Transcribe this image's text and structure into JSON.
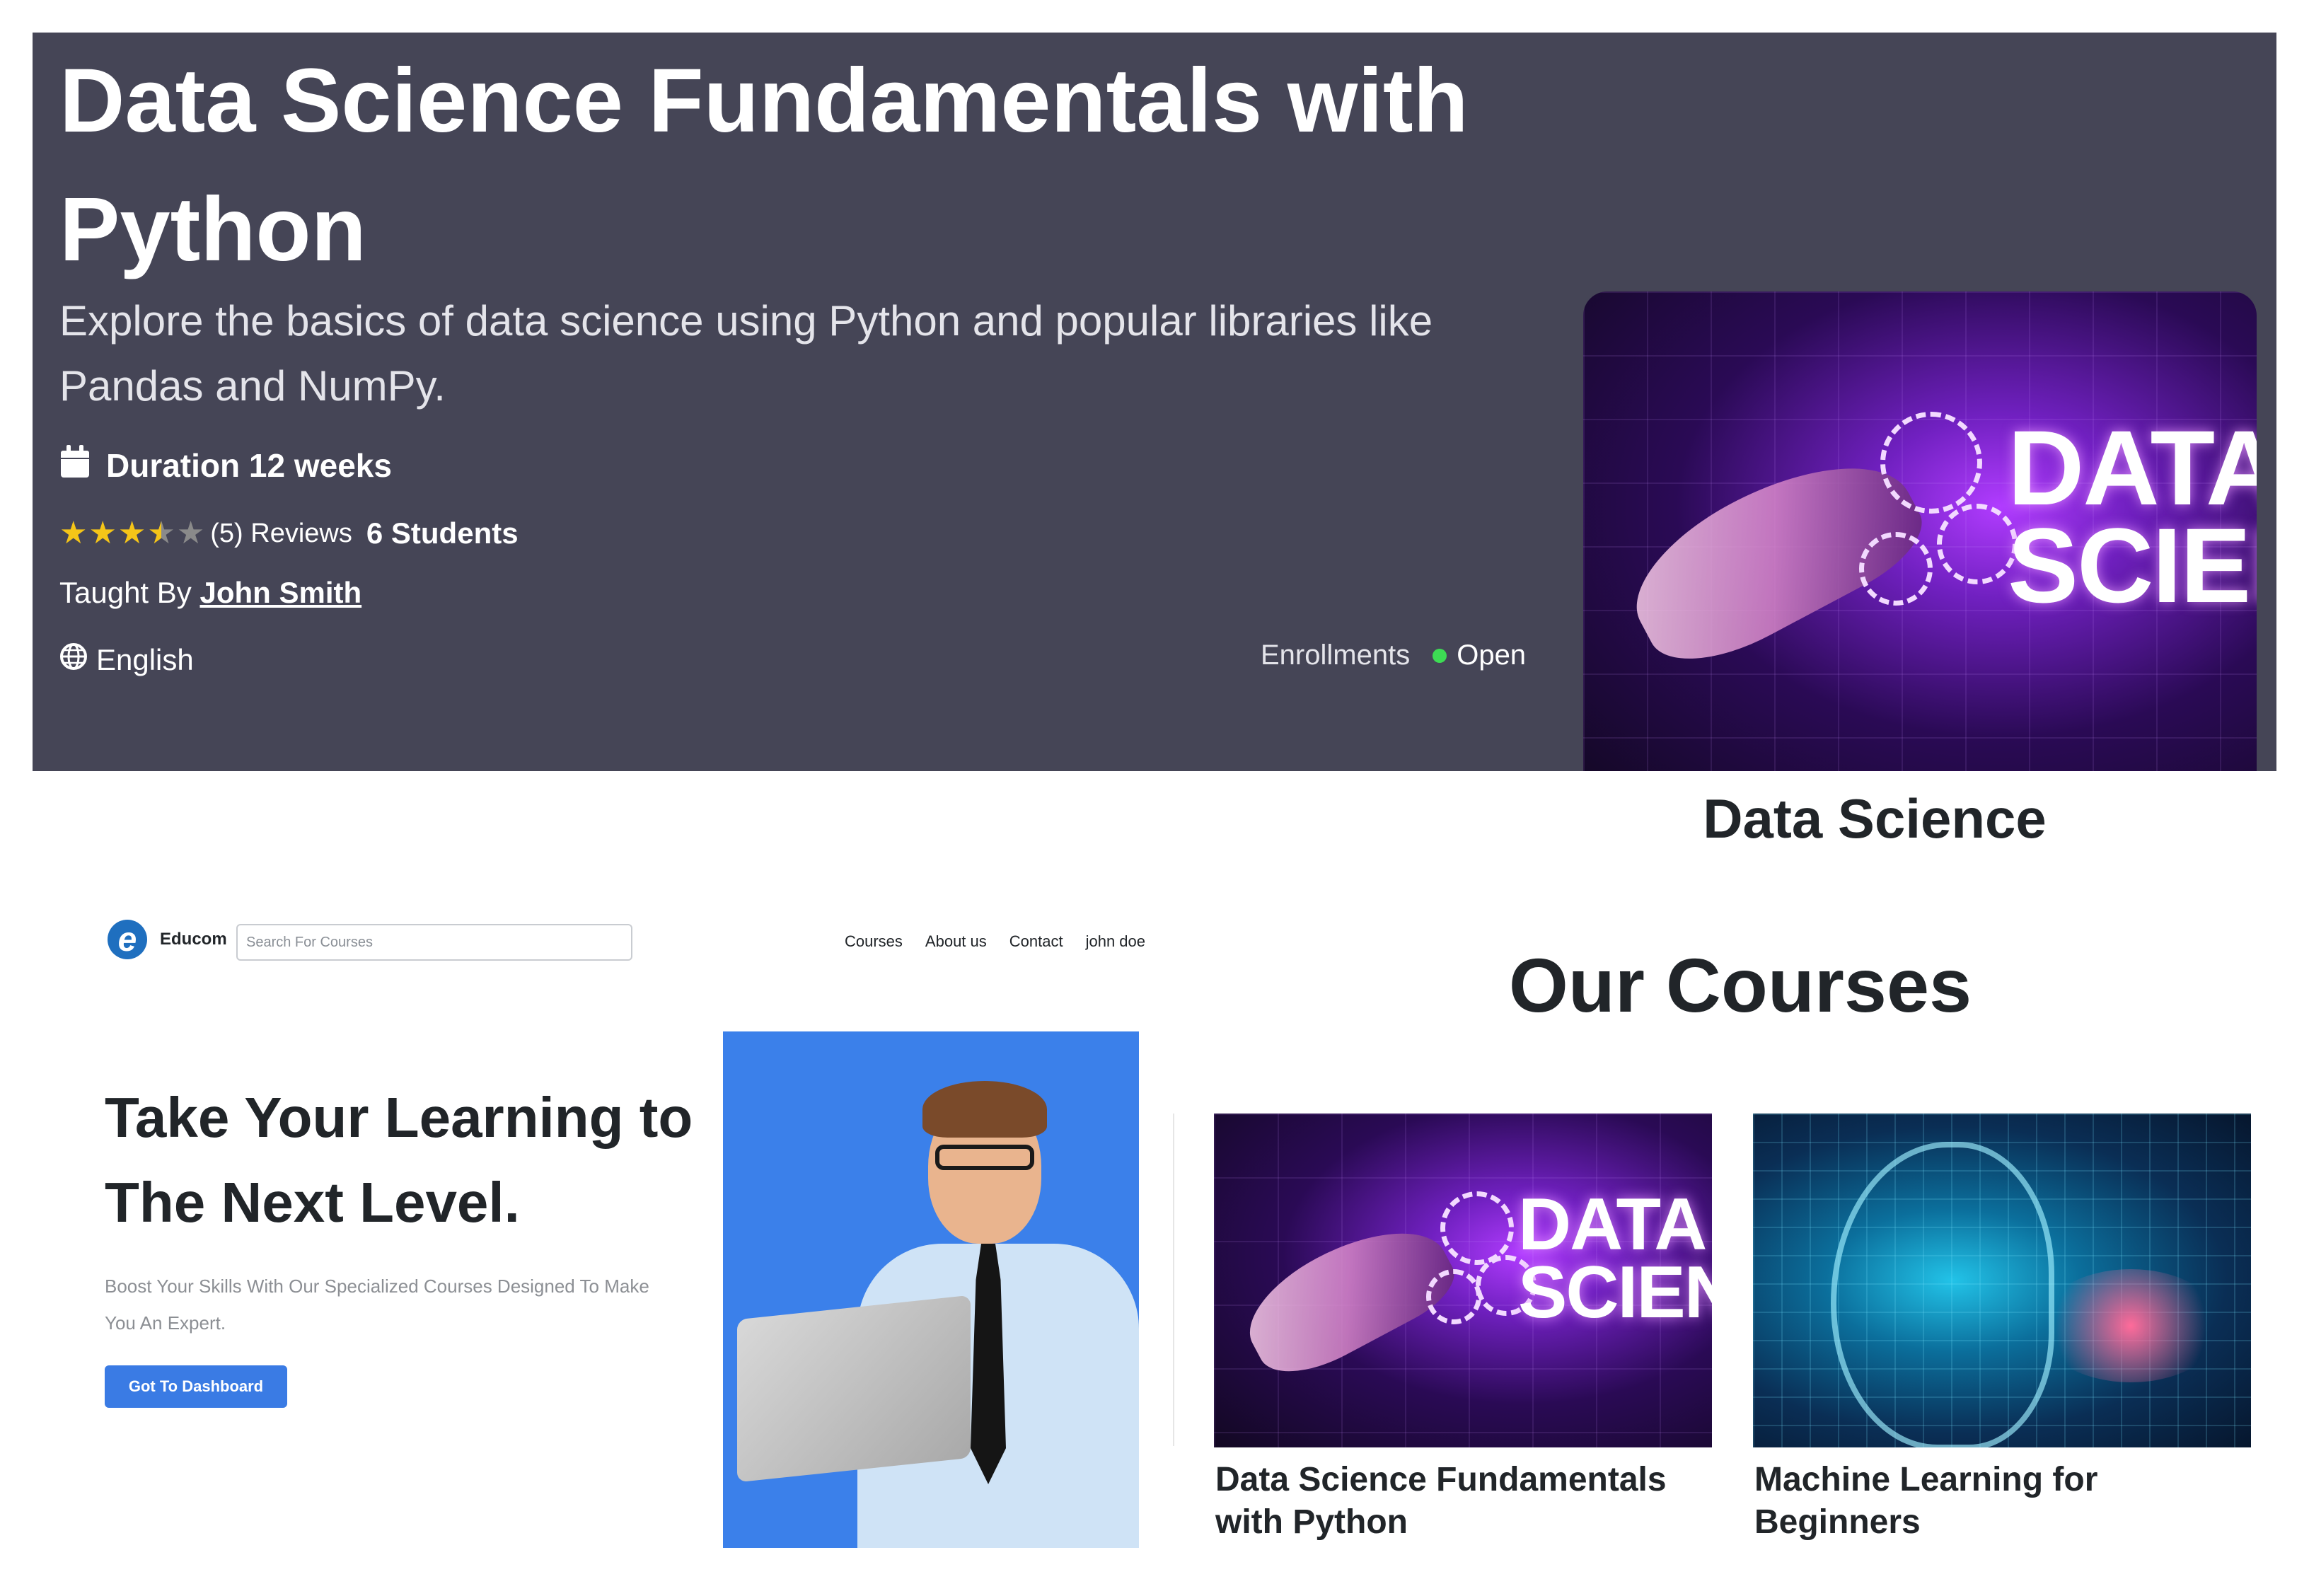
{
  "course": {
    "title": "Data Science Fundamentals with Python",
    "description": "Explore the basics of data science using Python and popular libraries like Pandas and NumPy.",
    "duration_label": "Duration 12 weeks",
    "rating": 3.5,
    "rating_max": 5,
    "reviews_label": "(5) Reviews",
    "students_label": "6 Students",
    "taught_by_label": "Taught By",
    "instructor": "John Smith",
    "language": "English",
    "enrollments_label": "Enrollments",
    "enrollment_status": "Open",
    "status_color": "#3ddc54",
    "category": "Data Science",
    "image_text": "DATA SCIENC"
  },
  "landing": {
    "logo_text": "Educom",
    "logo_letter": "e",
    "search_placeholder": "Search For Courses",
    "nav": [
      "Courses",
      "About us",
      "Contact",
      "john doe"
    ],
    "heading": "Take Your Learning to The Next Level.",
    "subtext": "Boost Your Skills With Our Specialized Courses Designed To Make You An Expert.",
    "cta_label": "Got To Dashboard",
    "accent_color": "#3a7be4"
  },
  "courses_section": {
    "heading": "Our Courses",
    "cards": [
      {
        "title": "Data Science Fundamentals with Python",
        "image_text": "DATA SCIENC"
      },
      {
        "title": "Machine Learning for Beginners"
      }
    ]
  },
  "colors": {
    "banner_bg": "#454556",
    "star_filled": "#f5c518",
    "star_empty": "#8a8a8a"
  },
  "icons": [
    "calendar-icon",
    "star-icon",
    "globe-icon",
    "status-dot-icon",
    "logo-icon"
  ]
}
